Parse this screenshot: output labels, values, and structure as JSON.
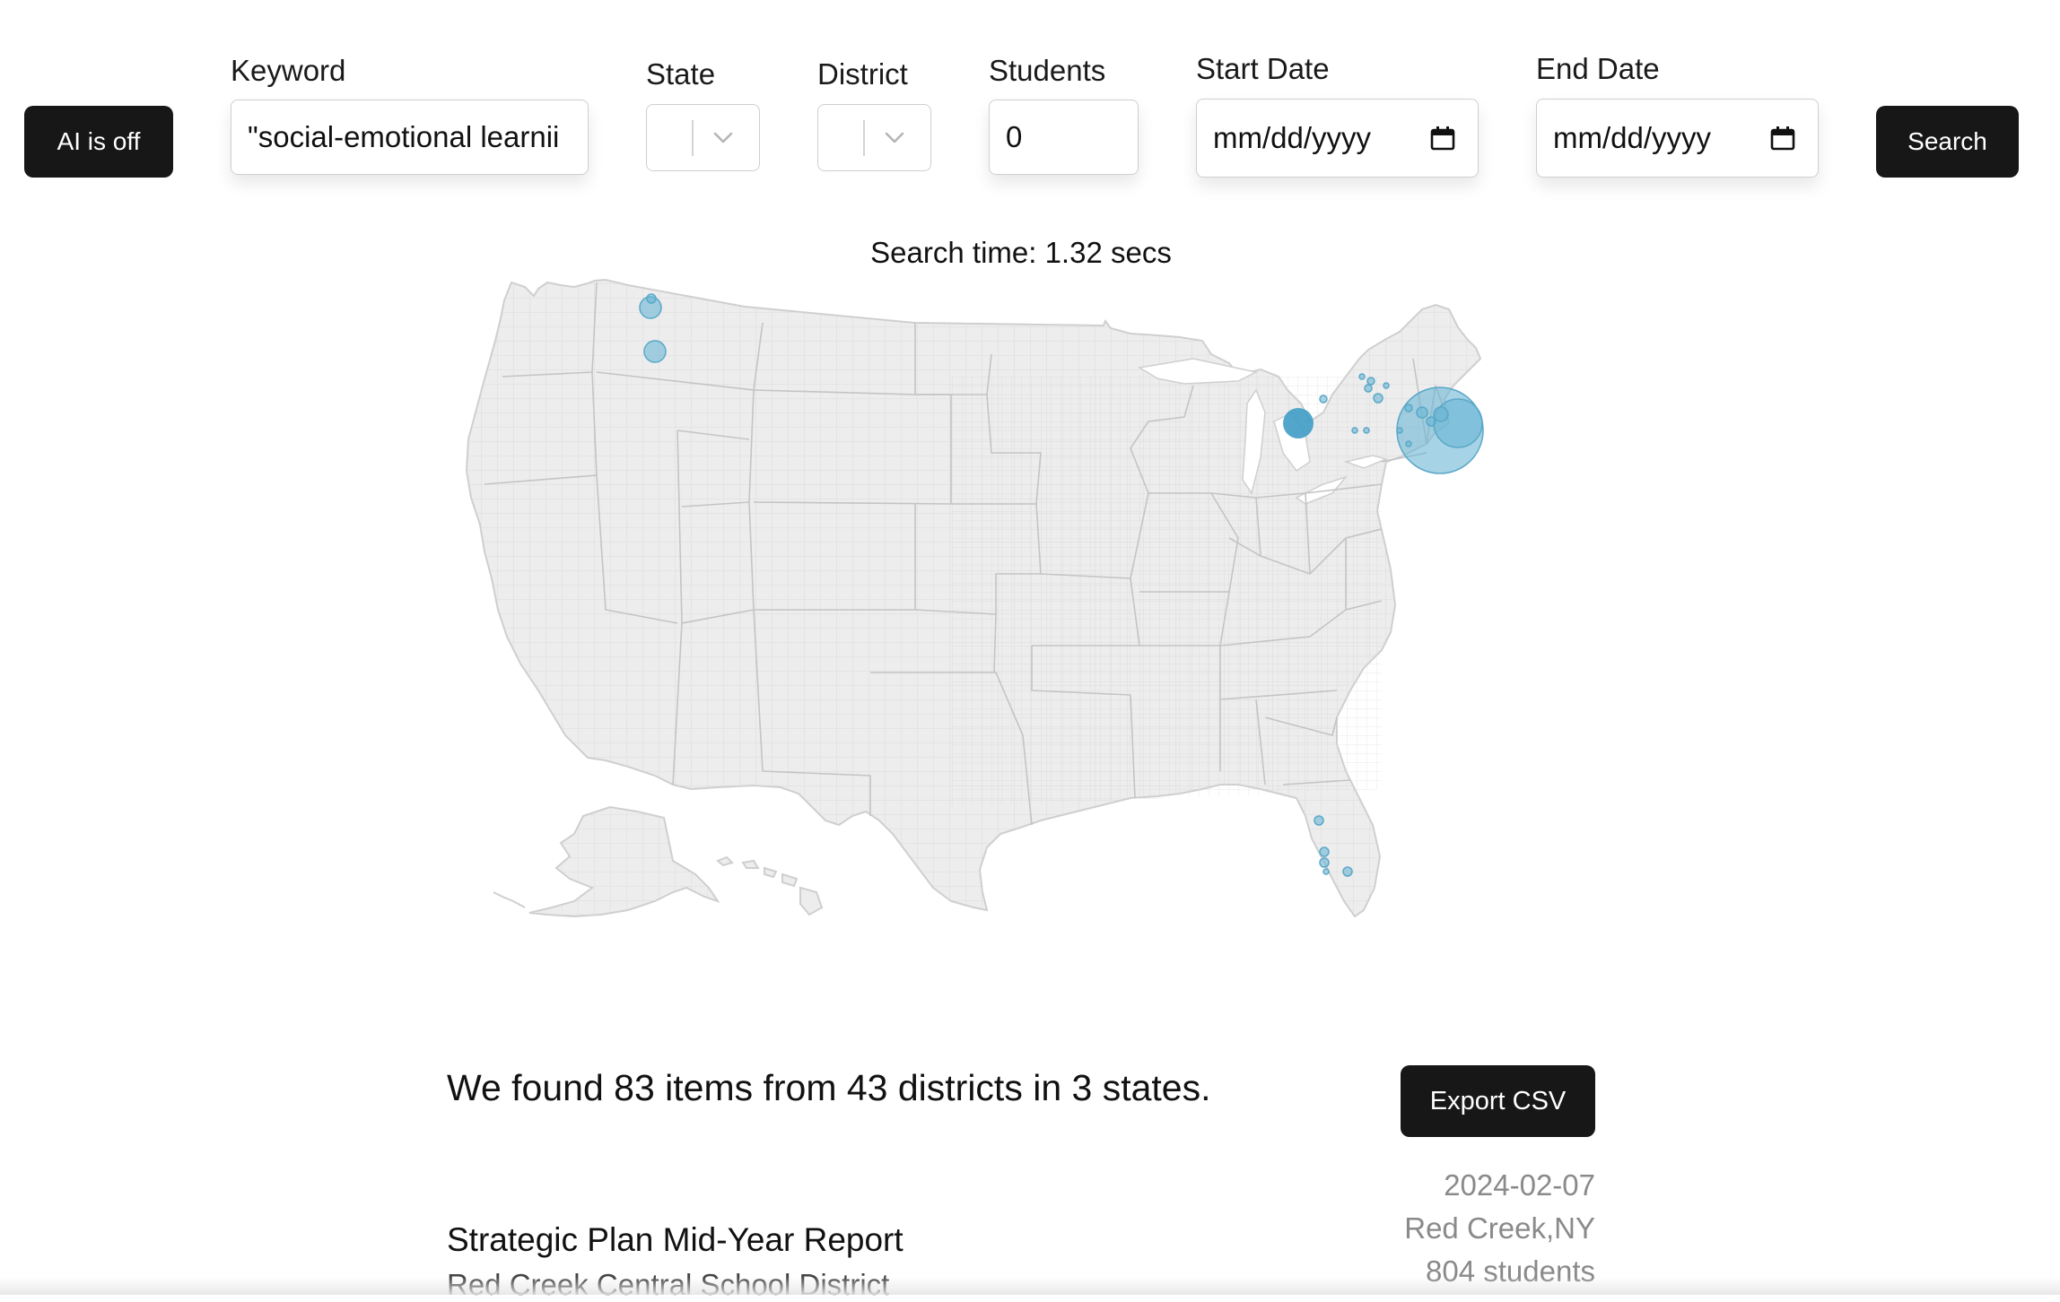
{
  "toolbar": {
    "ai_toggle_label": "AI is off",
    "search_label": "Search"
  },
  "filters": {
    "keyword": {
      "label": "Keyword",
      "value": "\"social-emotional learnii"
    },
    "state": {
      "label": "State",
      "value": ""
    },
    "district": {
      "label": "District",
      "value": ""
    },
    "students": {
      "label": "Students",
      "value": "0"
    },
    "start_date": {
      "label": "Start Date",
      "value": "mm/dd/yyyy"
    },
    "end_date": {
      "label": "End Date",
      "value": "mm/dd/yyyy"
    }
  },
  "search_time": "Search time: 1.32 secs",
  "map": {
    "land_color": "#ededed",
    "border_color": "#cfcfcf",
    "bubble_color": "#6bb6d3",
    "bubbles": [
      {
        "region": "WA",
        "size": "small"
      },
      {
        "region": "WA",
        "size": "small"
      },
      {
        "region": "Upstate NY",
        "size": "medium"
      },
      {
        "region": "NY metro",
        "size": "large"
      },
      {
        "region": "FL",
        "size": "tiny"
      }
    ]
  },
  "results": {
    "summary": "We found 83 items from 43 districts in 3 states.",
    "export_label": "Export CSV",
    "items": [
      {
        "title": "Strategic Plan Mid-Year Report",
        "district": "Red Creek Central School District",
        "date": "2024-02-07",
        "location": "Red Creek,NY",
        "students": "804 students"
      }
    ]
  }
}
